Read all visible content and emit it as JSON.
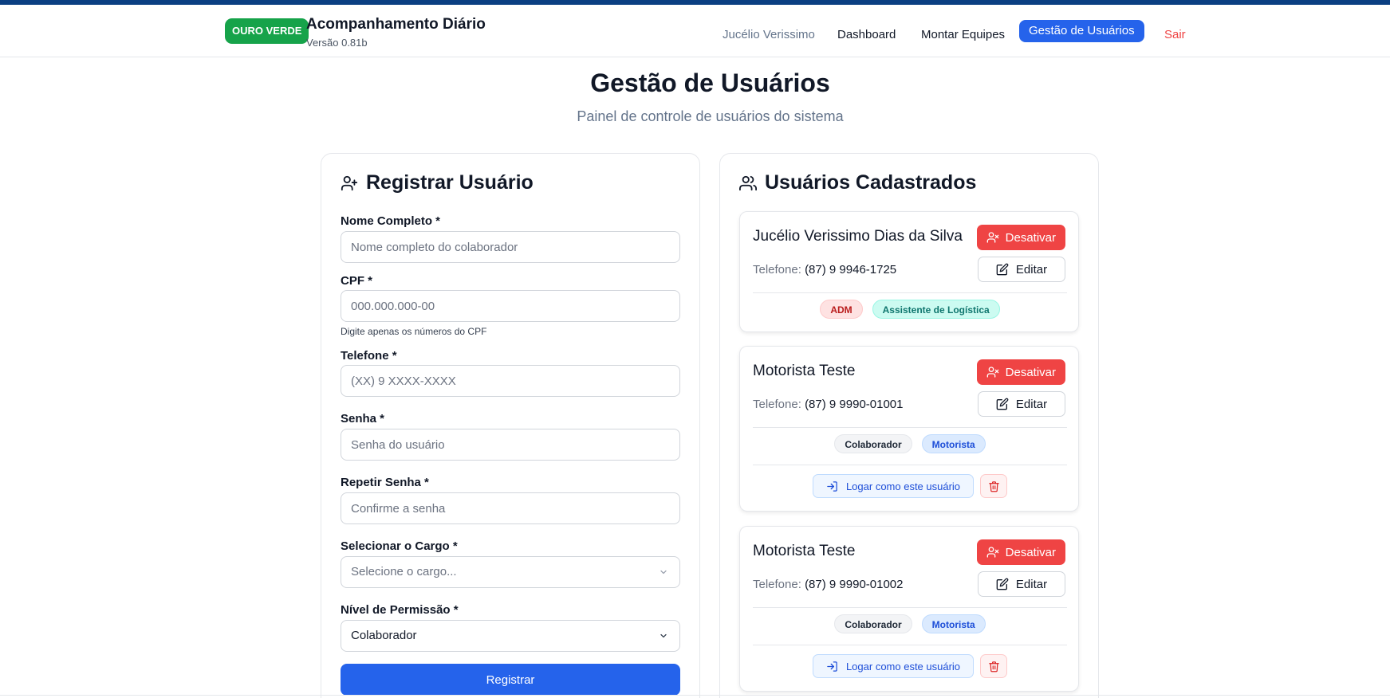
{
  "header": {
    "brand_badge": "OURO VERDE",
    "app_title": "Acompanhamento Diário",
    "version": "Versão 0.81b",
    "nav": {
      "user": "Jucélio Verissimo",
      "dashboard": "Dashboard",
      "teams": "Montar Equipes",
      "users": "Gestão de Usuários",
      "logout": "Sair"
    }
  },
  "page": {
    "title": "Gestão de Usuários",
    "subtitle": "Painel de controle de usuários do sistema"
  },
  "register_form": {
    "title": "Registrar Usuário",
    "name_label": "Nome Completo *",
    "name_placeholder": "Nome completo do colaborador",
    "cpf_label": "CPF *",
    "cpf_placeholder": "000.000.000-00",
    "cpf_hint": "Digite apenas os números do CPF",
    "phone_label": "Telefone *",
    "phone_placeholder": "(XX) 9 XXXX-XXXX",
    "password_label": "Senha *",
    "password_placeholder": "Senha do usuário",
    "confirm_label": "Repetir Senha *",
    "confirm_placeholder": "Confirme a senha",
    "role_label": "Selecionar o Cargo *",
    "role_placeholder": "Selecione o cargo...",
    "permission_label": "Nível de Permissão *",
    "permission_value": "Colaborador",
    "submit": "Registrar"
  },
  "users_list": {
    "title": "Usuários Cadastrados",
    "phone_label": "Telefone:",
    "deactivate_label": "Desativar",
    "edit_label": "Editar",
    "login_as_label": "Logar como este usuário",
    "users": [
      {
        "name": "Jucélio Verissimo Dias da Silva",
        "phone": "(87) 9 9946-1725",
        "permission": "ADM",
        "role": "Assistente de Logística"
      },
      {
        "name": "Motorista Teste",
        "phone": "(87) 9 9990-01001",
        "permission": "Colaborador",
        "role": "Motorista"
      },
      {
        "name": "Motorista Teste",
        "phone": "(87) 9 9990-01002",
        "permission": "Colaborador",
        "role": "Motorista"
      }
    ]
  },
  "colors": {
    "primary": "#2563eb",
    "brand_green": "#16a34a",
    "danger": "#ef4444",
    "top_bar": "#0b3f82"
  }
}
